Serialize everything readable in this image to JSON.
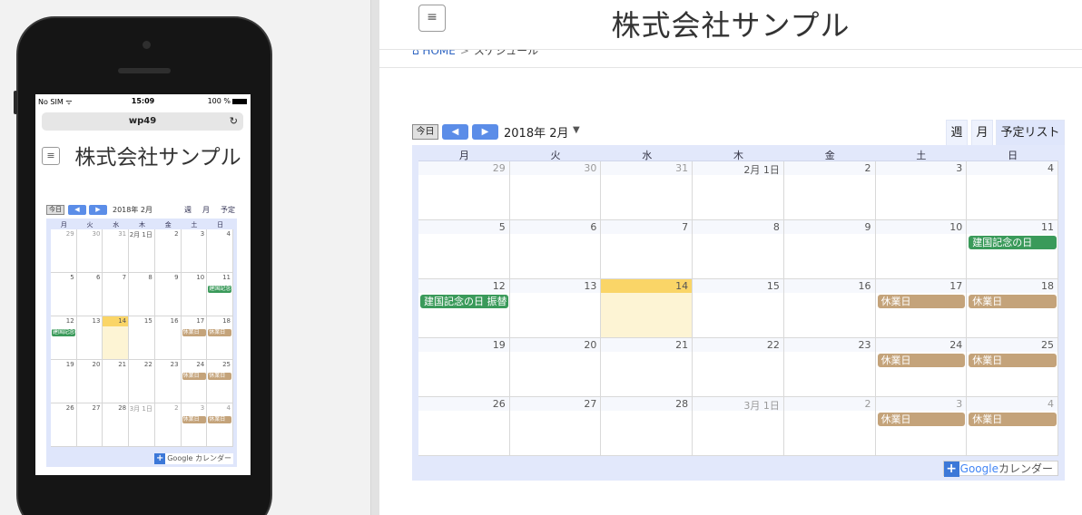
{
  "colors": {
    "accent_blue": "#5b8de8",
    "event_holiday": "#c4a37a",
    "event_national": "#3a9a5a",
    "today_bar": "#fad567",
    "today_bg": "#fdf4d4",
    "cal_border": "#e2e8fb"
  },
  "mobile": {
    "status": {
      "carrier": "No SIM ᯤ",
      "time": "15:09",
      "battery": "100 %"
    },
    "url": "wp49",
    "reload_icon": "↻",
    "site_title": "株式会社サンプル",
    "menu_icon": "≡",
    "toolbar": {
      "today": "今日",
      "prev": "◀",
      "next": "▶",
      "month": "2018年 2月",
      "view_week": "週",
      "view_month": "月",
      "view_list": "予定"
    },
    "gcal": "Google カレンダー"
  },
  "header": {
    "menu_icon": "≡",
    "site_title": "株式会社サンプル"
  },
  "breadcrumb": {
    "home": "⌂ HOME",
    "sep": ">",
    "current": "スケジュール"
  },
  "toolbar": {
    "today": "今日",
    "prev_icon": "◀",
    "next_icon": "▶",
    "month_label": "2018年 2月",
    "dropdown_icon": "▼",
    "view_week": "週",
    "view_month": "月",
    "view_list": "予定リスト"
  },
  "weekdays": [
    "月",
    "火",
    "水",
    "木",
    "金",
    "土",
    "日"
  ],
  "weeks": [
    [
      {
        "d": "29",
        "o": true
      },
      {
        "d": "30",
        "o": true
      },
      {
        "d": "31",
        "o": true
      },
      {
        "d": "2月 1日"
      },
      {
        "d": "2"
      },
      {
        "d": "3"
      },
      {
        "d": "4"
      }
    ],
    [
      {
        "d": "5"
      },
      {
        "d": "6"
      },
      {
        "d": "7"
      },
      {
        "d": "8"
      },
      {
        "d": "9"
      },
      {
        "d": "10"
      },
      {
        "d": "11"
      }
    ],
    [
      {
        "d": "12"
      },
      {
        "d": "13"
      },
      {
        "d": "14",
        "today": true
      },
      {
        "d": "15"
      },
      {
        "d": "16"
      },
      {
        "d": "17"
      },
      {
        "d": "18"
      }
    ],
    [
      {
        "d": "19"
      },
      {
        "d": "20"
      },
      {
        "d": "21"
      },
      {
        "d": "22"
      },
      {
        "d": "23"
      },
      {
        "d": "24"
      },
      {
        "d": "25"
      }
    ],
    [
      {
        "d": "26"
      },
      {
        "d": "27"
      },
      {
        "d": "28"
      },
      {
        "d": "3月 1日",
        "o": true
      },
      {
        "d": "2",
        "o": true
      },
      {
        "d": "3",
        "o": true
      },
      {
        "d": "4",
        "o": true
      }
    ]
  ],
  "events": [
    {
      "week": 1,
      "day": 6,
      "label": "建国記念の日",
      "kind": "national"
    },
    {
      "week": 2,
      "day": 0,
      "label": "建国記念の日 振替",
      "kind": "national"
    },
    {
      "week": 2,
      "day": 5,
      "label": "休業日",
      "kind": "holiday"
    },
    {
      "week": 2,
      "day": 6,
      "label": "休業日",
      "kind": "holiday"
    },
    {
      "week": 3,
      "day": 5,
      "label": "休業日",
      "kind": "holiday"
    },
    {
      "week": 3,
      "day": 6,
      "label": "休業日",
      "kind": "holiday"
    },
    {
      "week": 4,
      "day": 5,
      "label": "休業日",
      "kind": "holiday"
    },
    {
      "week": 4,
      "day": 6,
      "label": "休業日",
      "kind": "holiday"
    }
  ],
  "gcal_badge": {
    "plus": "+",
    "google": "Google",
    "label": "カレンダー"
  }
}
